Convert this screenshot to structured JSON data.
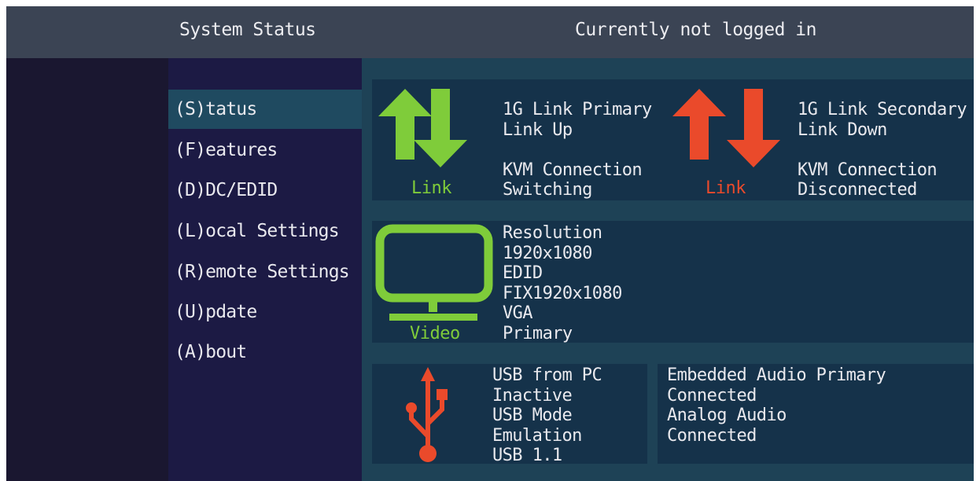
{
  "header": {
    "title": "System Status",
    "login_status": "Currently not logged in"
  },
  "menu": {
    "items": [
      {
        "label": "(S)tatus",
        "active": true
      },
      {
        "label": "(F)eatures",
        "active": false
      },
      {
        "label": "(D)DC/EDID",
        "active": false
      },
      {
        "label": "(L)ocal  Settings",
        "active": false
      },
      {
        "label": "(R)emote Settings",
        "active": false
      },
      {
        "label": "(U)pdate",
        "active": false
      },
      {
        "label": "(A)bout",
        "active": false
      }
    ]
  },
  "status": {
    "link_primary": {
      "icon": "link-up-arrows-icon",
      "color": "#7fcc3a",
      "caption": "Link",
      "lines": [
        "1G Link Primary",
        "Link Up",
        "",
        "KVM Connection",
        "Switching"
      ]
    },
    "link_secondary": {
      "icon": "link-down-arrows-icon",
      "color": "#ea4a2b",
      "caption": "Link",
      "lines": [
        "1G Link Secondary",
        "Link Down",
        "",
        "KVM Connection",
        "Disconnected"
      ]
    },
    "video": {
      "icon": "monitor-icon",
      "color": "#7fcc3a",
      "caption": "Video",
      "lines": [
        "Resolution",
        "1920x1080",
        "EDID",
        "FIX1920x1080",
        "VGA",
        "Primary"
      ]
    },
    "usb": {
      "icon": "usb-icon",
      "color": "#ea4a2b",
      "lines": [
        "USB from PC",
        "Inactive",
        "USB Mode",
        "Emulation",
        "USB 1.1"
      ]
    },
    "audio": {
      "lines": [
        "Embedded Audio Primary",
        "Connected",
        "Analog Audio",
        "Connected"
      ]
    }
  }
}
